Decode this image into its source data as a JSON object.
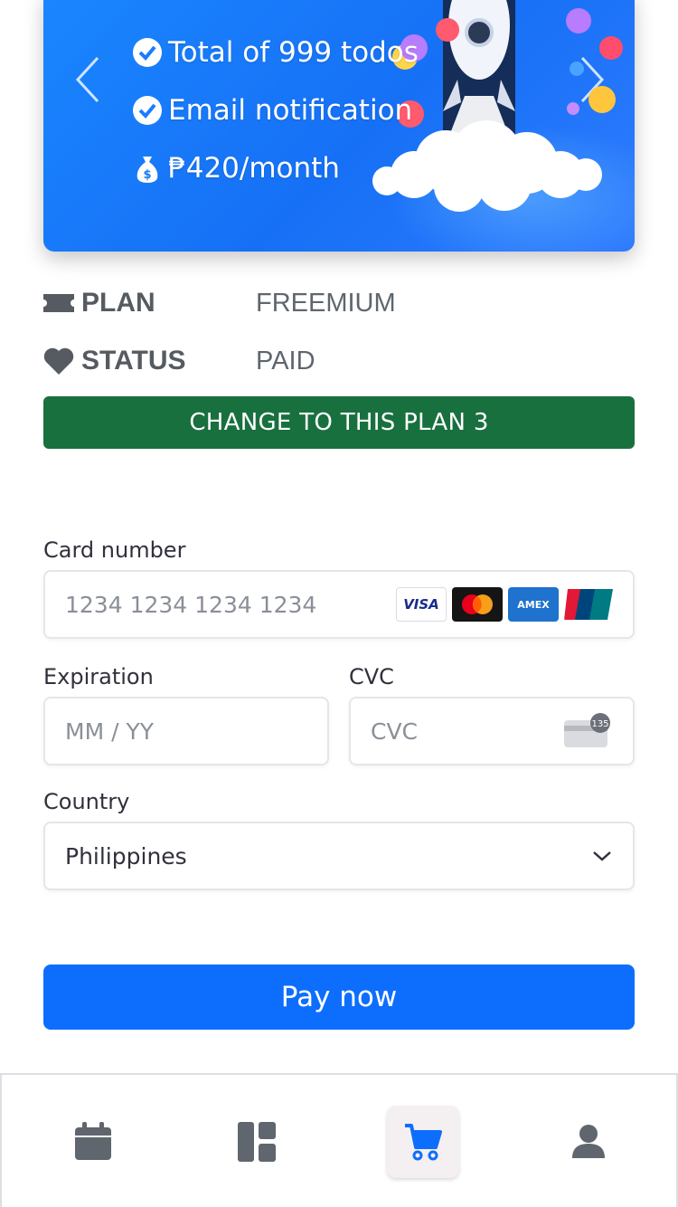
{
  "banner": {
    "features": [
      {
        "icon": "check-circle-icon",
        "text": "Total of 999 todos"
      },
      {
        "icon": "check-circle-icon",
        "text": "Email notification"
      },
      {
        "icon": "money-bag-icon",
        "text": "₱420/month"
      }
    ]
  },
  "plan_info": {
    "plan_label": "PLAN",
    "plan_value": "FREEMIUM",
    "status_label": "STATUS",
    "status_value": "PAID"
  },
  "change_plan_button": "CHANGE TO THIS PLAN 3",
  "payment_form": {
    "card_number_label": "Card number",
    "card_number_placeholder": "1234 1234 1234 1234",
    "card_brands": [
      "VISA",
      "Mastercard",
      "AMEX",
      "UnionPay"
    ],
    "expiration_label": "Expiration",
    "expiration_placeholder": "MM / YY",
    "cvc_label": "CVC",
    "cvc_placeholder": "CVC",
    "cvc_icon_number": "135",
    "country_label": "Country",
    "country_value": "Philippines"
  },
  "pay_button": "Pay now",
  "bottom_nav": {
    "items": [
      {
        "icon": "calendar-icon",
        "active": false
      },
      {
        "icon": "dashboard-icon",
        "active": false
      },
      {
        "icon": "cart-icon",
        "active": true
      },
      {
        "icon": "user-icon",
        "active": false
      }
    ],
    "active_color": "#0d6efd",
    "inactive_color": "#5f666d"
  },
  "colors": {
    "banner": "#1a7cff",
    "change_button": "#19703f",
    "pay_button": "#0d6efd"
  }
}
